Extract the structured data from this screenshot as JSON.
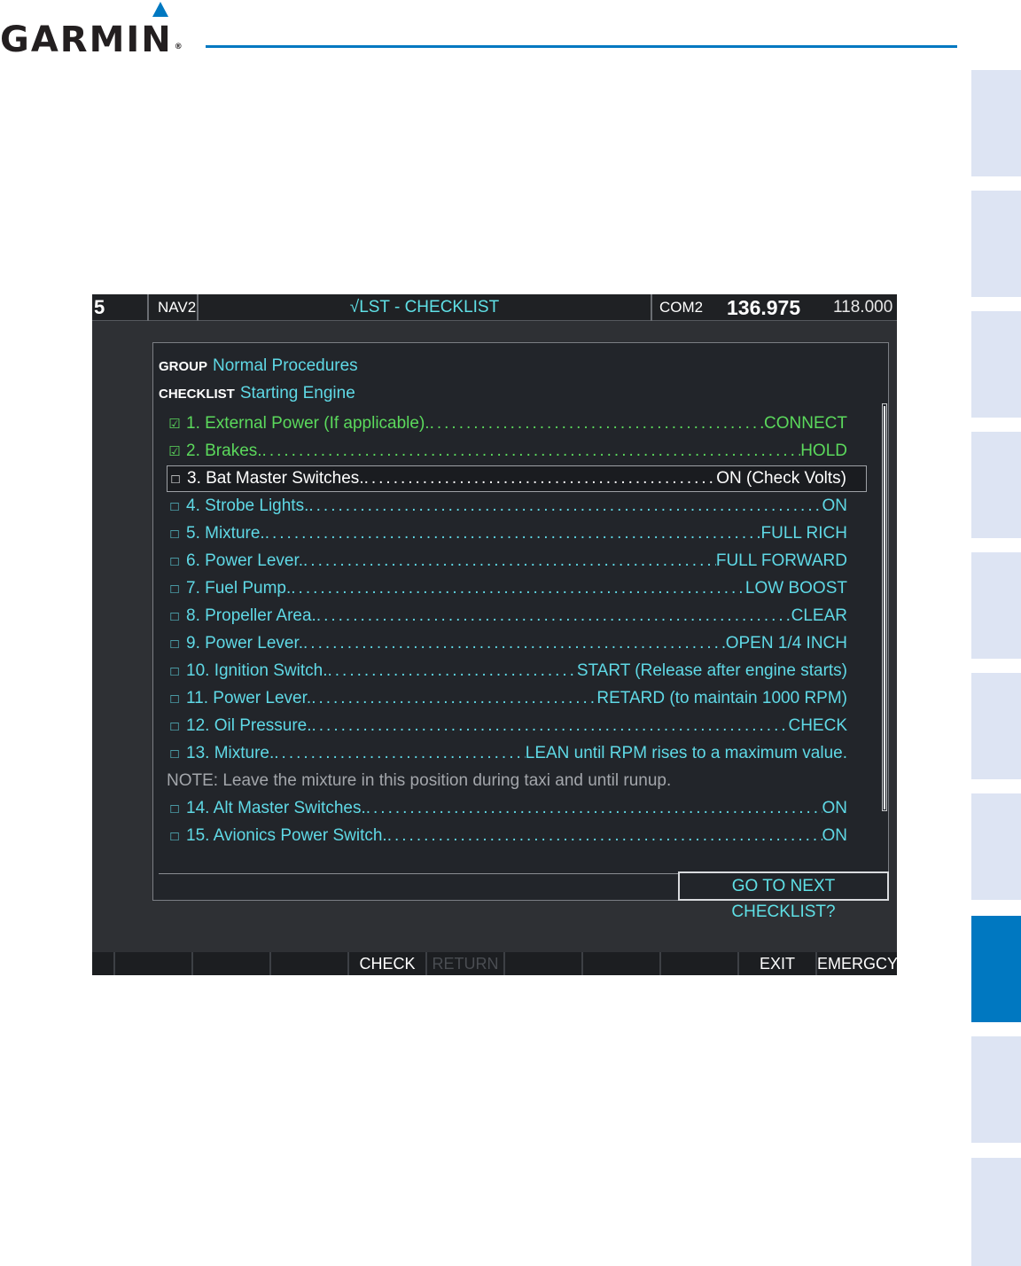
{
  "header": {
    "logo_text": "GARMIN",
    "logo_mark": "®",
    "accent_color": "#0078c1"
  },
  "mfd": {
    "topbar": {
      "left_digit": "5",
      "nav_label": "NAV2",
      "page_title": "√LST - CHECKLIST",
      "com_label": "COM2",
      "com_active": "136.975",
      "com_standby": "118.000"
    },
    "group_label": "GROUP",
    "group_value": "Normal Procedures",
    "checklist_label": "CHECKLIST",
    "checklist_value": "Starting Engine",
    "items": [
      {
        "checked": "☑",
        "name": "1. External Power (If applicable).",
        "action": "CONNECT",
        "state": "done"
      },
      {
        "checked": "☑",
        "name": "2. Brakes.",
        "action": "HOLD",
        "state": "done"
      },
      {
        "checked": "□",
        "name": "3. Bat Master Switches.",
        "action": "ON (Check Volts)",
        "state": "selected"
      },
      {
        "checked": "□",
        "name": "4. Strobe Lights.",
        "action": "ON",
        "state": "pending"
      },
      {
        "checked": "□",
        "name": "5. Mixture.",
        "action": "FULL RICH",
        "state": "pending"
      },
      {
        "checked": "□",
        "name": "6. Power Lever.",
        "action": "FULL FORWARD",
        "state": "pending"
      },
      {
        "checked": "□",
        "name": "7. Fuel Pump.",
        "action": "LOW BOOST",
        "state": "pending"
      },
      {
        "checked": "□",
        "name": "8. Propeller Area.",
        "action": "CLEAR",
        "state": "pending"
      },
      {
        "checked": "□",
        "name": "9. Power Lever.",
        "action": "OPEN 1/4 INCH",
        "state": "pending"
      },
      {
        "checked": "□",
        "name": "10. Ignition Switch.",
        "action": "START (Release after engine starts)",
        "state": "pending"
      },
      {
        "checked": "□",
        "name": "11. Power Lever.",
        "action": "RETARD (to maintain 1000 RPM)",
        "state": "pending"
      },
      {
        "checked": "□",
        "name": "12. Oil Pressure.",
        "action": "CHECK",
        "state": "pending"
      },
      {
        "checked": "□",
        "name": "13. Mixture.",
        "action": "LEAN until RPM rises to a maximum value.",
        "state": "pending"
      }
    ],
    "note": "NOTE:  Leave the mixture in this position during taxi and until runup.",
    "items_after_note": [
      {
        "checked": "□",
        "name": "14. Alt Master Switches.",
        "action": "ON",
        "state": "pending"
      },
      {
        "checked": "□",
        "name": "15. Avionics Power Switch.",
        "action": "ON",
        "state": "pending"
      }
    ],
    "go_next_label": "GO TO NEXT CHECKLIST?",
    "softkeys": [
      "",
      "",
      "",
      "",
      "CHECK",
      "RETURN",
      "",
      "",
      "",
      "EXIT",
      "EMERGCY"
    ],
    "colors": {
      "done": "#5bd95c",
      "pending": "#5fd9e6",
      "selected": "#ffffff",
      "note": "#a3a6ab"
    }
  }
}
